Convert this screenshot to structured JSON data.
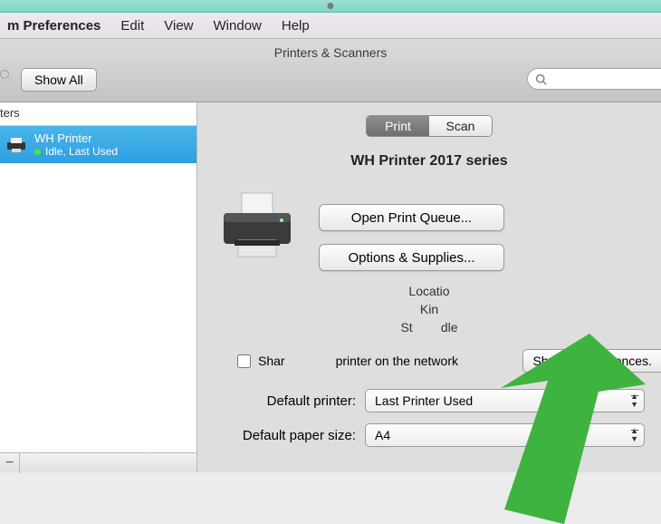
{
  "menubar": {
    "app": "m Preferences",
    "items": [
      "Edit",
      "View",
      "Window",
      "Help"
    ]
  },
  "window": {
    "title": "Printers & Scanners",
    "show_all": "Show All",
    "search_placeholder": ""
  },
  "sidebar": {
    "header": "ters",
    "printer": {
      "name": "WH Printer",
      "status": "Idle, Last Used"
    }
  },
  "tabs": {
    "print": "Print",
    "scan": "Scan",
    "active": "print"
  },
  "printer_detail": {
    "title": "WH Printer 2017 series",
    "open_queue": "Open Print Queue...",
    "options_supplies": "Options & Supplies...",
    "location_label": "Locatio",
    "kind_label": "Kin",
    "status_label": "St",
    "status_value": "dle"
  },
  "share": {
    "label_pre": "Shar",
    "label_post": "printer on the network",
    "button": "Sharing Preferences."
  },
  "defaults": {
    "printer_label": "Default printer:",
    "printer_value": "Last Printer Used",
    "paper_label": "Default paper size:",
    "paper_value": "A4"
  }
}
